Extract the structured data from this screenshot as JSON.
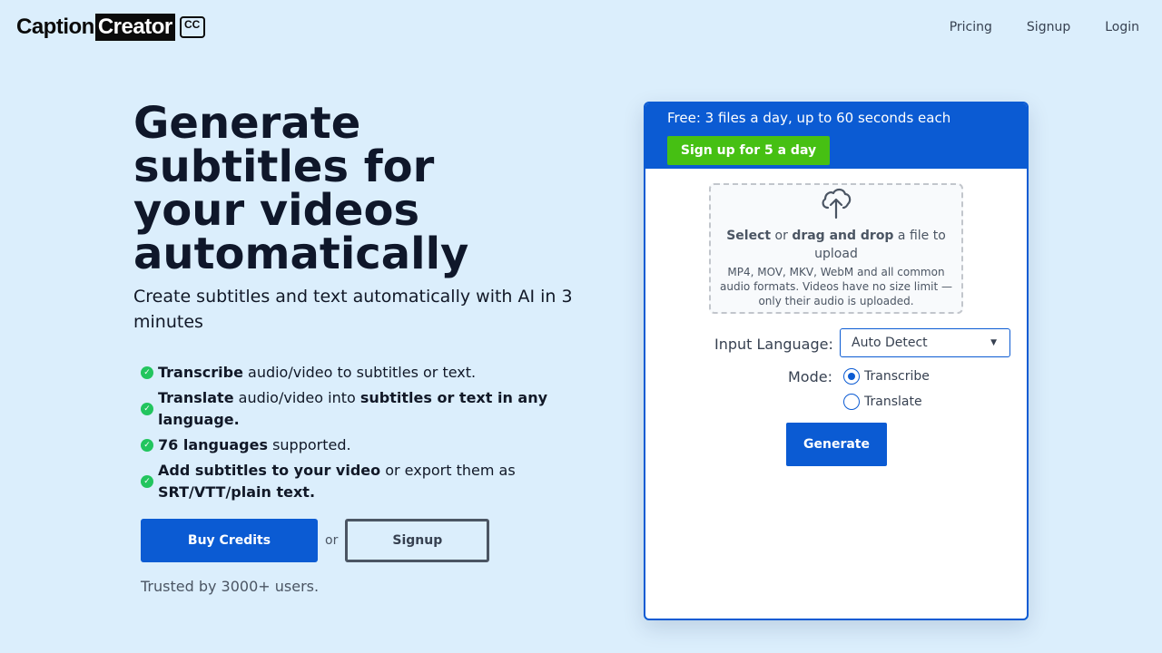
{
  "brand": {
    "part1": "Caption",
    "part2": "Creator",
    "badge": "CC"
  },
  "nav": {
    "pricing": "Pricing",
    "signup": "Signup",
    "login": "Login"
  },
  "hero": {
    "title": "Generate subtitles for your videos automatically",
    "subtitle": "Create subtitles and text automatically with AI in 3 minutes"
  },
  "features": [
    {
      "b1": "Transcribe",
      "t1": " audio/video to subtitles or text.",
      "b2": "",
      "t2": ""
    },
    {
      "b1": "Translate",
      "t1": " audio/video into ",
      "b2": "subtitles or text in any language.",
      "t2": ""
    },
    {
      "b1": "76 languages",
      "t1": " supported.",
      "b2": "",
      "t2": ""
    },
    {
      "b1": "Add subtitles to your video",
      "t1": " or export them as ",
      "b2": "SRT/VTT/plain text.",
      "t2": ""
    }
  ],
  "cta": {
    "buy": "Buy Credits",
    "or": "or",
    "signup": "Signup",
    "trusted": "Trusted by 3000+ users."
  },
  "panel": {
    "free_text": "Free: 3 files a day, up to 60 seconds each",
    "signup_five": "Sign up for 5 a day",
    "upload": {
      "select": "Select",
      "or": " or ",
      "drag": "drag and drop",
      "rest": " a file to upload",
      "hint": "MP4, MOV, MKV, WebM and all common audio formats. Videos have no size limit — only their audio is uploaded."
    },
    "input_language_label": "Input Language:",
    "input_language_value": "Auto Detect",
    "mode_label": "Mode:",
    "modes": [
      {
        "label": "Transcribe",
        "selected": true
      },
      {
        "label": "Translate",
        "selected": false
      }
    ],
    "generate": "Generate"
  },
  "colors": {
    "background": "#dbeefc",
    "primary": "#0b5bd3",
    "green": "#46c013",
    "check": "#22c55e"
  }
}
